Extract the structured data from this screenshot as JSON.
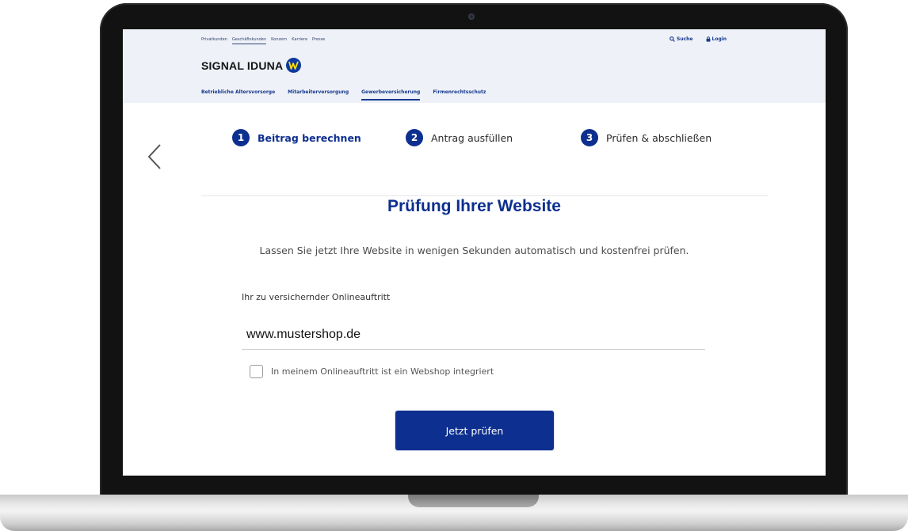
{
  "top_nav": {
    "utility_links": [
      "Privatkunden",
      "Geschäftskunden",
      "Konzern",
      "Karriere",
      "Presse"
    ],
    "active_utility": 1,
    "search_label": "Suche",
    "login_label": "Login"
  },
  "brand": {
    "logo_text": "SIGNAL IDUNA"
  },
  "main_nav": {
    "items": [
      "Betriebliche Altersvorsorge",
      "Mitarbeiterversorgung",
      "Gewerbeversicherung",
      "Firmenrechtsschutz"
    ],
    "active_index": 2
  },
  "steps": [
    {
      "number": "1",
      "label": "Beitrag berechnen"
    },
    {
      "number": "2",
      "label": "Antrag ausfüllen"
    },
    {
      "number": "3",
      "label": "Prüfen & abschließen"
    }
  ],
  "content": {
    "title": "Prüfung Ihrer Website",
    "subtitle": "Lassen Sie jetzt Ihre Website in wenigen Sekunden automatisch und kostenfrei prüfen.",
    "field_label": "Ihr zu versichernder Onlineauftritt",
    "field_value": "www.mustershop.de",
    "checkbox_label": "In meinem Onlineauftritt ist ein Webshop integriert",
    "checkbox_checked": false,
    "button_label": "Jetzt prüfen"
  },
  "colors": {
    "primary": "#0d2f8f",
    "logo_accent": "#ffe000",
    "header_bg": "#eef1f8"
  }
}
